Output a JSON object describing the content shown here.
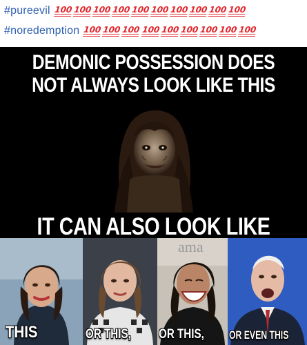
{
  "post": {
    "hashtags": [
      {
        "text": "#pureevil",
        "emoji": "100-icon",
        "emoji_count": 10
      },
      {
        "text": "#noredemption",
        "emoji": "100-icon",
        "emoji_count": 9
      }
    ],
    "emoji_glyph": "100"
  },
  "meme": {
    "caption_line1": "DEMONIC  POSSESSION DOES",
    "caption_line2": "NOT ALWAYS LOOK LIKE THIS",
    "caption_mid": "IT CAN ALSO LOOK LIKE",
    "background_sign_text": "ama",
    "panels": [
      {
        "label": "THIS"
      },
      {
        "label": "OR THIS,"
      },
      {
        "label": "OR THIS,"
      },
      {
        "label": "OR EVEN THIS"
      }
    ]
  },
  "colors": {
    "hashtag": "#2f5fb3",
    "emoji_red": "#e0242a",
    "meme_bg": "#000000",
    "caption": "#ffffff"
  }
}
